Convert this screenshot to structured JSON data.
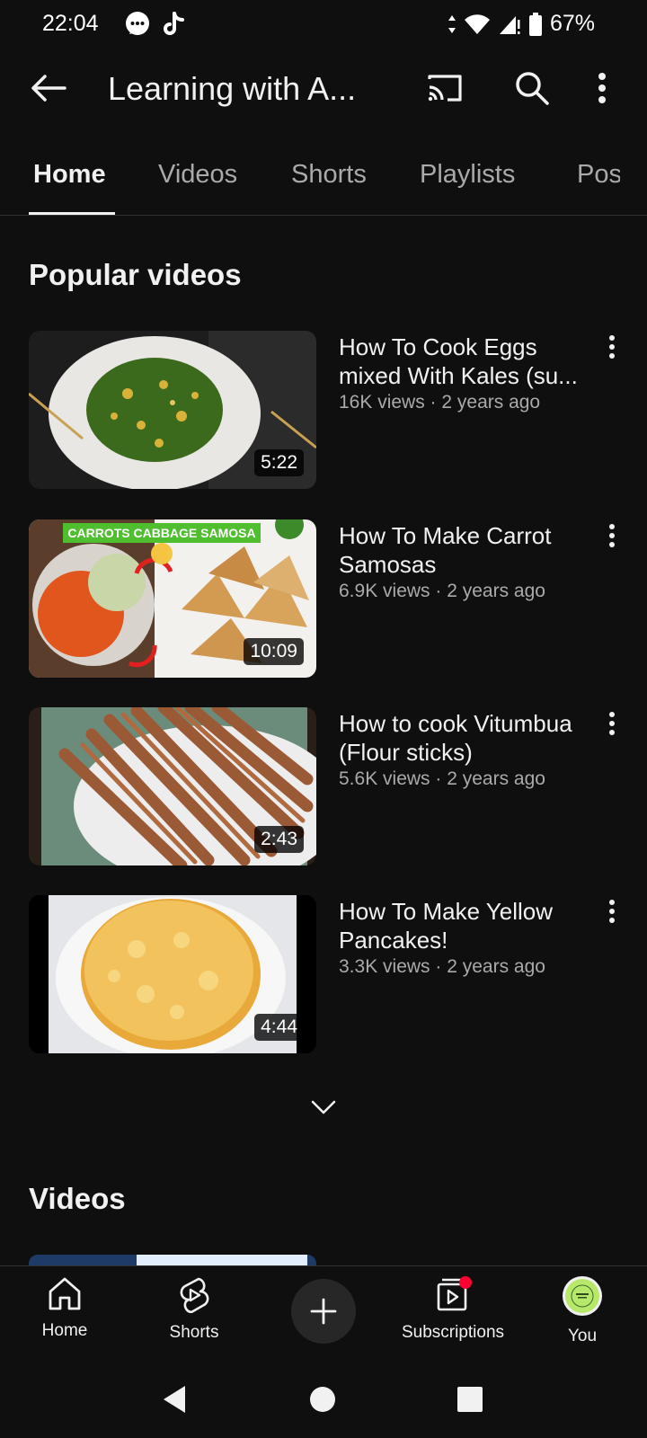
{
  "status_bar": {
    "time": "22:04",
    "battery": "67%"
  },
  "app_bar": {
    "title": "Learning with A..."
  },
  "tabs": [
    {
      "label": "Home",
      "active": true
    },
    {
      "label": "Videos",
      "active": false
    },
    {
      "label": "Shorts",
      "active": false
    },
    {
      "label": "Playlists",
      "active": false
    },
    {
      "label": "Pos",
      "active": false
    }
  ],
  "sections": {
    "popular_title": "Popular videos",
    "videos_title": "Videos"
  },
  "popular_videos": [
    {
      "title": "How To Cook Eggs mixed With Kales (su...",
      "meta": "16K views · 2 years ago",
      "duration": "5:22"
    },
    {
      "title": "How To Make Carrot Samosas",
      "meta": "6.9K views · 2 years ago",
      "duration": "10:09",
      "thumb_text": "CARROTS CABBAGE SAMOSA"
    },
    {
      "title": "How to cook Vitumbua (Flour sticks)",
      "meta": "5.6K views · 2 years ago",
      "duration": "2:43"
    },
    {
      "title": "How To Make Yellow Pancakes!",
      "meta": "3.3K views · 2 years ago",
      "duration": "4:44"
    }
  ],
  "bottom_nav": {
    "home": "Home",
    "shorts": "Shorts",
    "subscriptions": "Subscriptions",
    "you": "You"
  },
  "colors": {
    "background": "#0f0f0f",
    "secondary_text": "#aaaaaa",
    "notification_dot": "#ff0033"
  }
}
